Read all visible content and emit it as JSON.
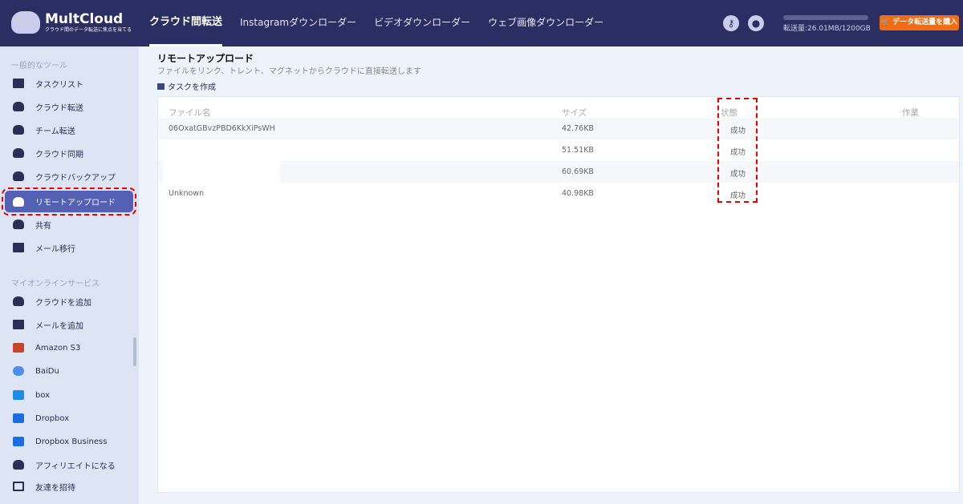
{
  "header": {
    "brand": "MultCloud",
    "tagline": "クラウド間のデータ転送に焦点を当てる",
    "nav": [
      "クラウド間転送",
      "Instagramダウンローダー",
      "ビデオダウンローダー",
      "ウェブ画像ダウンローダー"
    ],
    "quota_text": "転送量:26.01MB/1200GB",
    "buy_label": "データ転送量を購入"
  },
  "sidebar": {
    "section1": "一般的なツール",
    "tools": [
      "タスクリスト",
      "クラウド転送",
      "チーム転送",
      "クラウド同期",
      "クラウドバックアップ",
      "リモートアップロード",
      "共有",
      "メール移行"
    ],
    "section2": "マイオンラインサービス",
    "services": [
      "クラウドを追加",
      "メールを追加",
      "Amazon S3",
      "BaiDu",
      "box",
      "Dropbox",
      "Dropbox Business",
      "アフィリエイトになる",
      "友達を招待"
    ]
  },
  "main": {
    "title": "リモートアップロード",
    "subtitle": "ファイルをリンク、トレント、マグネットからクラウドに直接転送します",
    "create_label": "タスクを作成",
    "columns": [
      "ファイル名",
      "サイズ",
      "状態",
      "作業"
    ],
    "rows": [
      {
        "name": "06OxatGBvzPBD6KkXiPsWH",
        "size": "42.76KB",
        "status": "成功"
      },
      {
        "name": "",
        "size": "51.51KB",
        "status": "成功"
      },
      {
        "name": "",
        "size": "60.69KB",
        "status": "成功"
      },
      {
        "name": "Unknown",
        "size": "40.98KB",
        "status": "成功"
      }
    ]
  }
}
